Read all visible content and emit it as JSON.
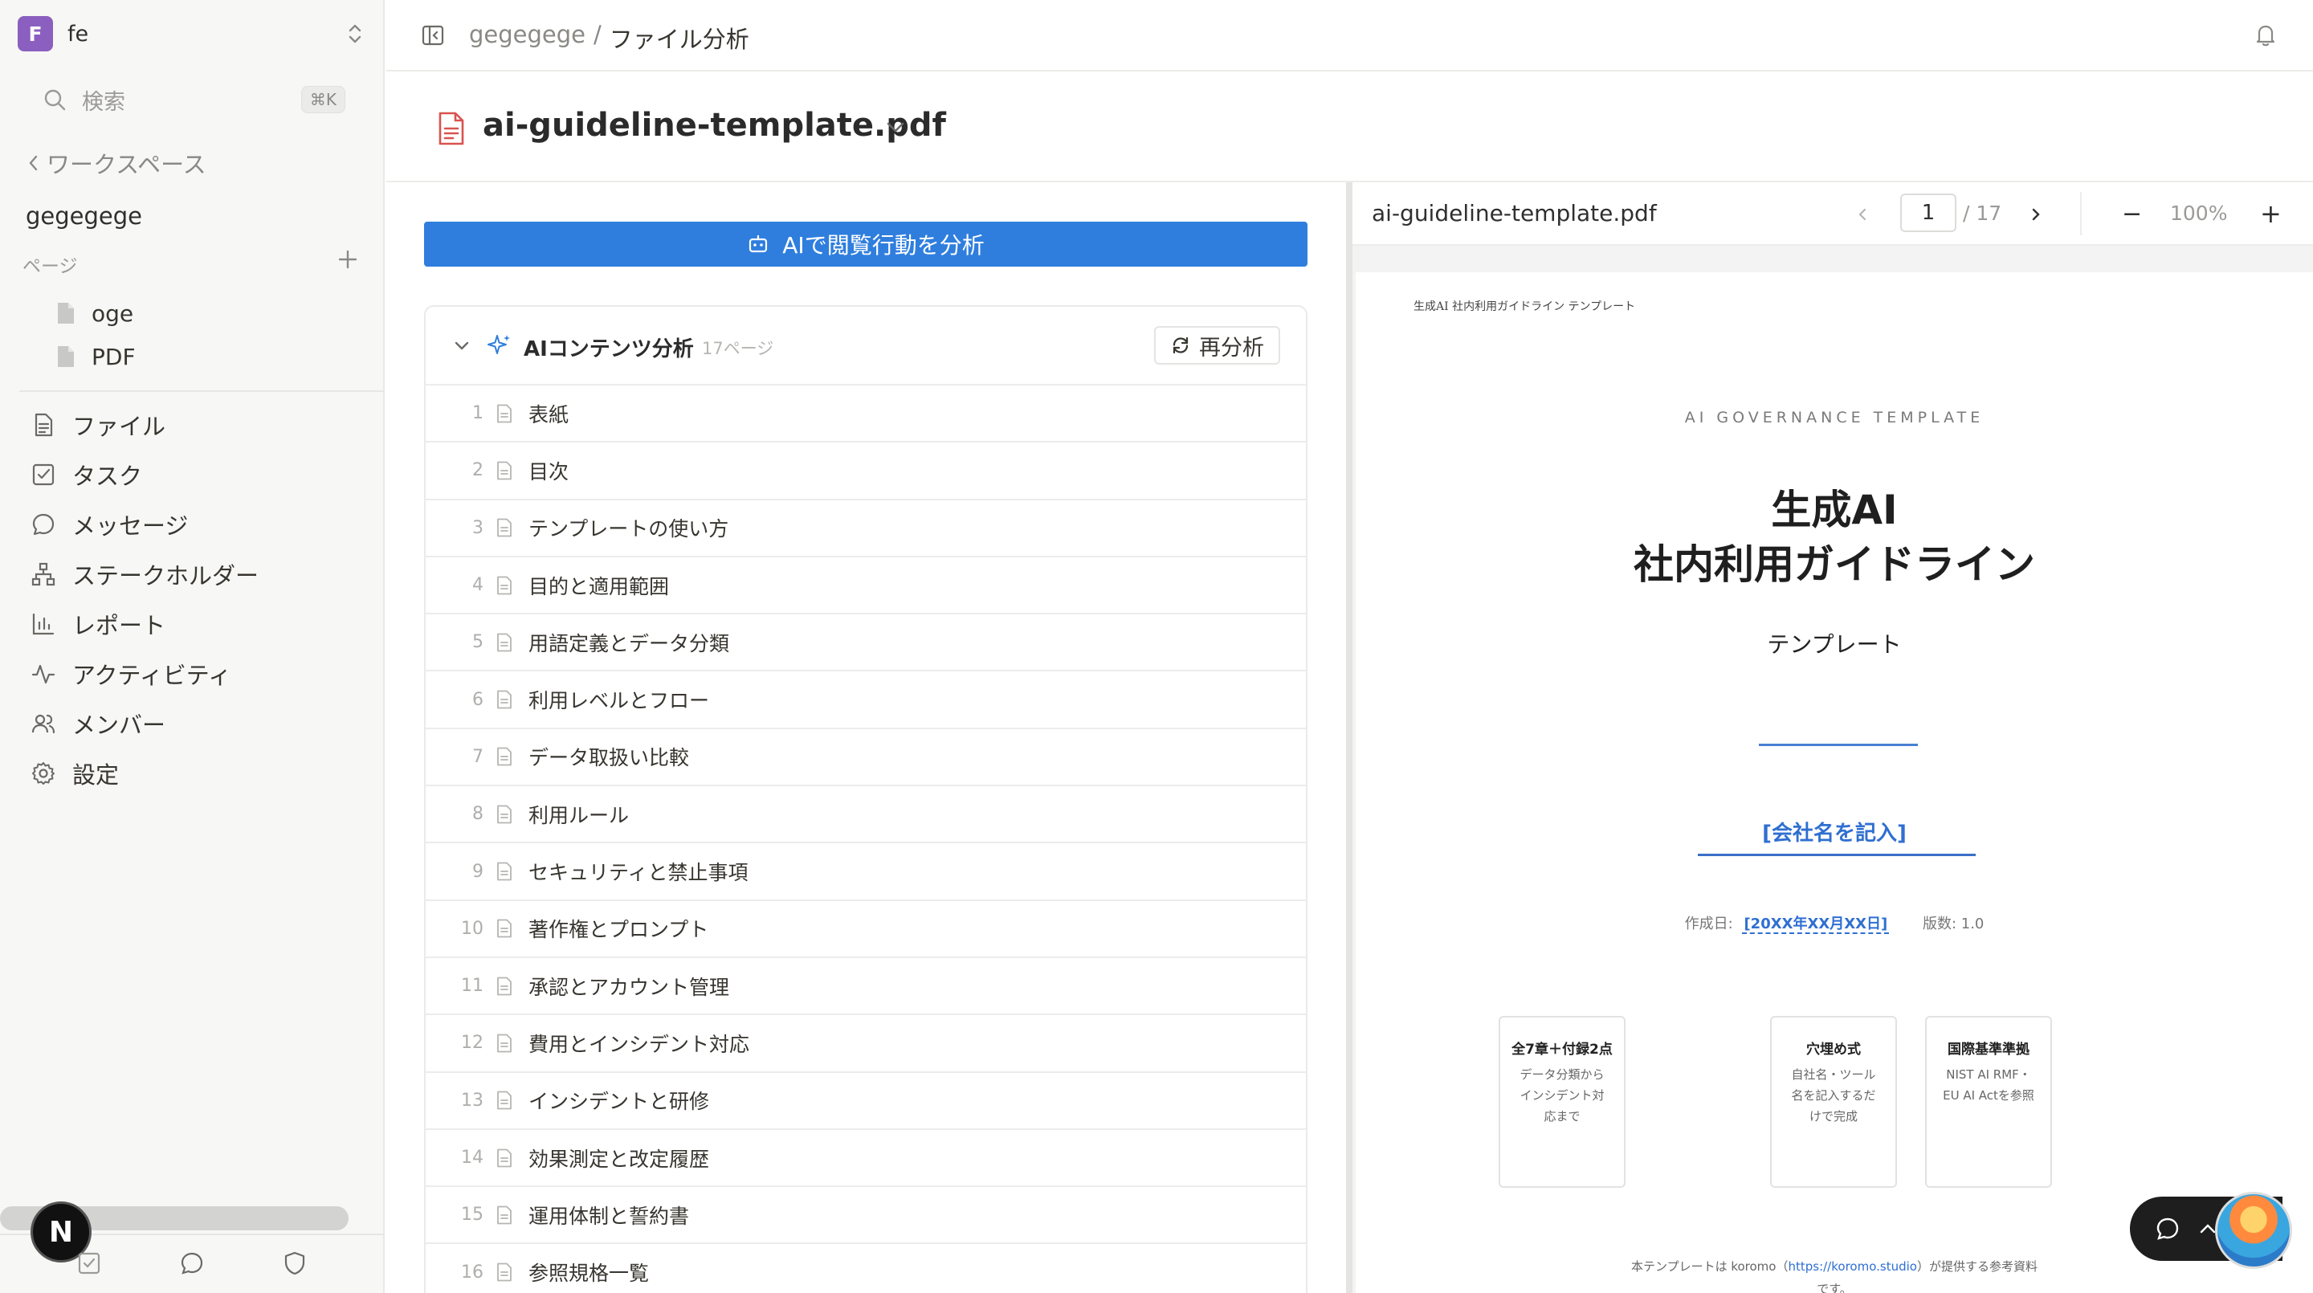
{
  "workspace": {
    "badge": "F",
    "name": "fe"
  },
  "search": {
    "label": "検索",
    "shortcut": "⌘K"
  },
  "sidebar": {
    "back_label": "ワークスペース",
    "project_name": "gegegege",
    "pages_label": "ページ",
    "pages": [
      {
        "label": "oge"
      },
      {
        "label": "PDF"
      }
    ],
    "nav": [
      {
        "label": "ファイル",
        "icon": "file-icon"
      },
      {
        "label": "タスク",
        "icon": "task-icon"
      },
      {
        "label": "メッセージ",
        "icon": "message-icon"
      },
      {
        "label": "ステークホルダー",
        "icon": "stakeholder-icon"
      },
      {
        "label": "レポート",
        "icon": "report-icon"
      },
      {
        "label": "アクティビティ",
        "icon": "activity-icon"
      },
      {
        "label": "メンバー",
        "icon": "members-icon"
      },
      {
        "label": "設定",
        "icon": "gear-icon"
      }
    ],
    "bottom_avatar": "N"
  },
  "breadcrumb": {
    "project": "gegegege",
    "separator": "/",
    "current": "ファイル分析"
  },
  "file": {
    "name": "ai-guideline-template.pdf"
  },
  "analyze_button": {
    "label": "AIで閲覧行動を分析"
  },
  "content_analysis": {
    "title": "AIコンテンツ分析",
    "page_count": "17ページ",
    "reanalyze_label": "再分析",
    "rows": [
      {
        "num": "1",
        "title": "表紙"
      },
      {
        "num": "2",
        "title": "目次"
      },
      {
        "num": "3",
        "title": "テンプレートの使い方"
      },
      {
        "num": "4",
        "title": "目的と適用範囲"
      },
      {
        "num": "5",
        "title": "用語定義とデータ分類"
      },
      {
        "num": "6",
        "title": "利用レベルとフロー"
      },
      {
        "num": "7",
        "title": "データ取扱い比較"
      },
      {
        "num": "8",
        "title": "利用ルール"
      },
      {
        "num": "9",
        "title": "セキュリティと禁止事項"
      },
      {
        "num": "10",
        "title": "著作権とプロンプト"
      },
      {
        "num": "11",
        "title": "承認とアカウント管理"
      },
      {
        "num": "12",
        "title": "費用とインシデント対応"
      },
      {
        "num": "13",
        "title": "インシデントと研修"
      },
      {
        "num": "14",
        "title": "効果測定と改定履歴"
      },
      {
        "num": "15",
        "title": "運用体制と誓約書"
      },
      {
        "num": "16",
        "title": "参照規格一覧"
      }
    ]
  },
  "viewer": {
    "file_name": "ai-guideline-template.pdf",
    "current_page": "1",
    "total_pages": "/ 17",
    "zoom": "100%",
    "minus": "−",
    "plus": "+"
  },
  "pdf_page": {
    "running_header": "生成AI 社内利用ガイドライン テンプレート",
    "kicker": "AI GOVERNANCE TEMPLATE",
    "title_line1": "生成AI",
    "title_line2": "社内利用ガイドライン",
    "subtitle": "テンプレート",
    "company_placeholder": "[会社名を記入]",
    "created_label": "作成日:",
    "created_value": "[20XX年XX月XX日]",
    "version": "版数: 1.0",
    "boxes": [
      {
        "title": "全7章＋付録2点",
        "body": "データ分類からインシデント対応まで"
      },
      {
        "title": "穴埋め式",
        "body": "自社名・ツール名を記入するだけで完成"
      },
      {
        "title": "国際基準準拠",
        "body": "NIST AI RMF・EU AI Actを参照"
      }
    ],
    "footer_prefix": "本テンプレートは koromo（",
    "footer_link": "https://koromo.studio",
    "footer_suffix": "）が提供する参考資料",
    "footer_line2": "です。"
  },
  "colors": {
    "accent": "#2f7ede",
    "workspace_badge": "#8b5fbf",
    "file_icon": "#d9534f",
    "sidebar_bg": "#f7f7f5"
  }
}
